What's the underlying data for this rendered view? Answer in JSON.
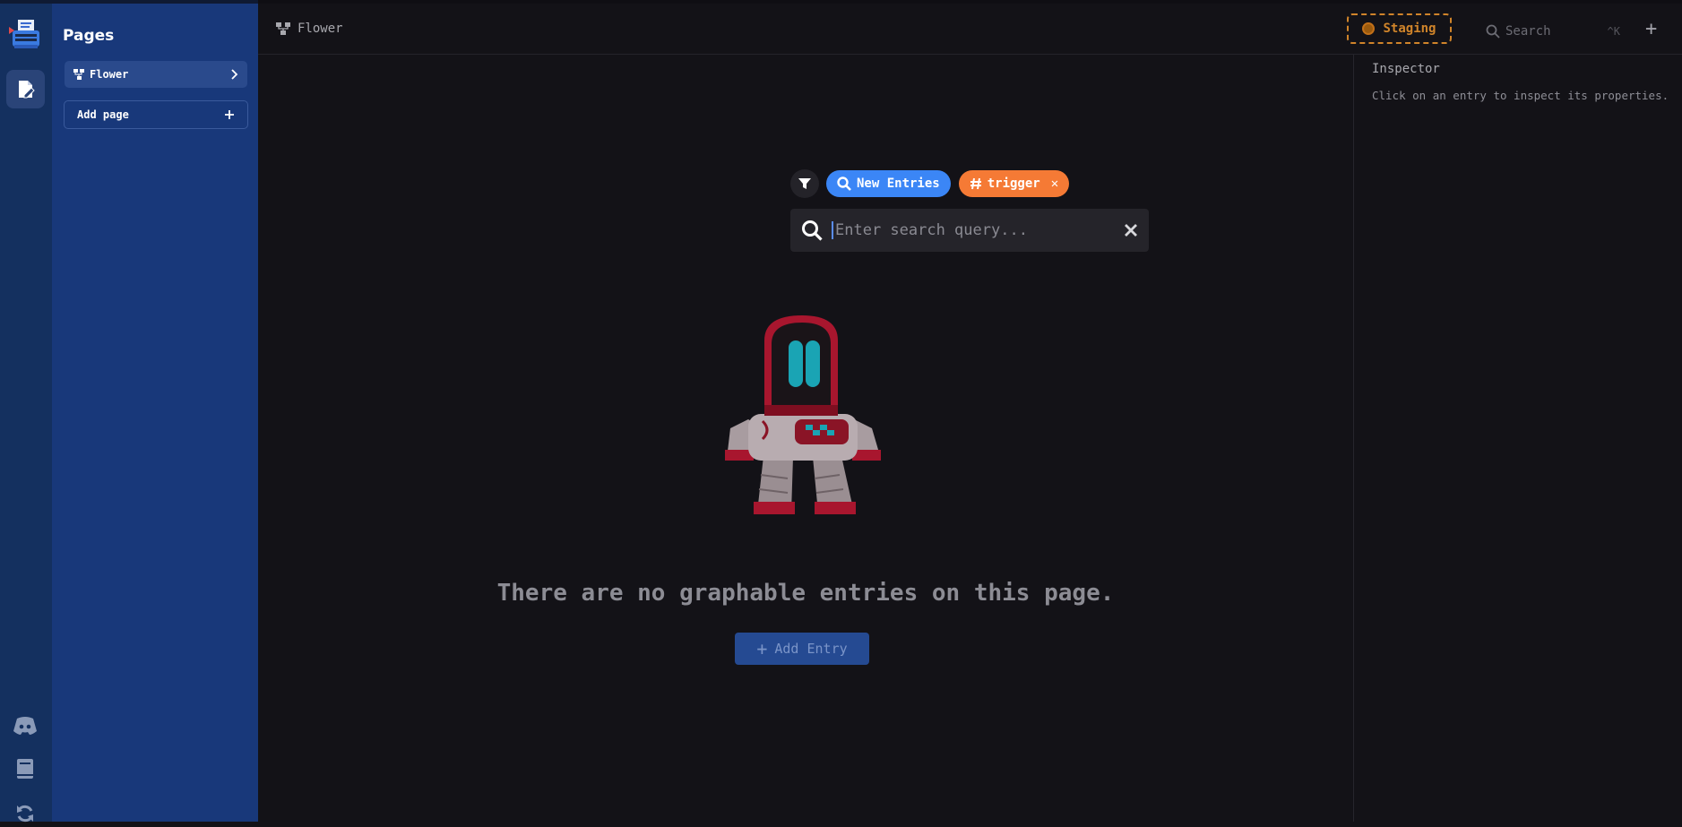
{
  "sidebar": {
    "title": "Pages",
    "pages": [
      {
        "label": "Flower",
        "icon": "flowchart-icon"
      }
    ],
    "add_page_label": "Add page"
  },
  "rail": {
    "icons": [
      "app-logo-icon",
      "pages-icon",
      "discord-icon",
      "book-icon",
      "refresh-icon"
    ]
  },
  "header": {
    "breadcrumb": "Flower",
    "environment": "Staging",
    "search_placeholder": "Search",
    "search_shortcut": "^K"
  },
  "filters": {
    "chips": [
      {
        "label": "New Entries",
        "icon": "search-icon",
        "color": "#3b86f6"
      },
      {
        "label": "trigger",
        "icon": "hash-icon",
        "color": "#f57a35",
        "removable": true
      }
    ],
    "query_placeholder": "Enter search query...",
    "query_value": ""
  },
  "main": {
    "empty_message": "There are no graphable entries on this page.",
    "add_entry_label": "Add Entry"
  },
  "inspector": {
    "title": "Inspector",
    "hint": "Click on an entry to inspect its properties."
  },
  "colors": {
    "background": "#131217",
    "sidebar": "#18387a",
    "rail": "#14305f",
    "accent_blue": "#3b86f6",
    "accent_orange": "#f57a35",
    "staging": "#d0842a"
  }
}
